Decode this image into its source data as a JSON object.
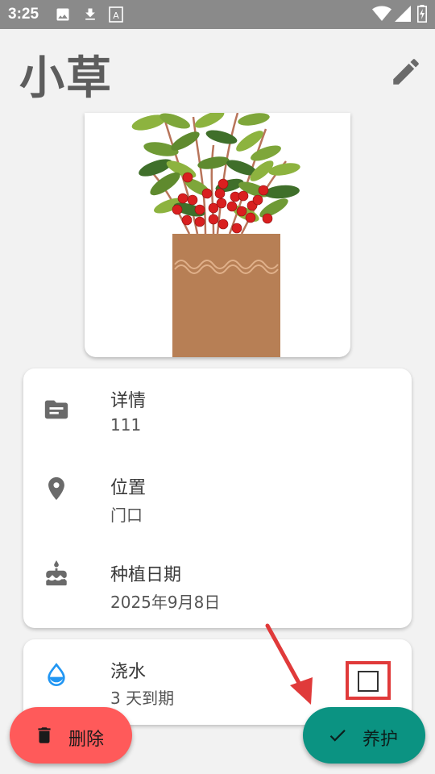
{
  "status_bar": {
    "time": "3:25",
    "icons": [
      "image-icon",
      "download-icon",
      "a-box-icon",
      "wifi-icon",
      "signal-icon",
      "battery-icon"
    ]
  },
  "header": {
    "title": "小草",
    "edit_icon": "pencil-icon"
  },
  "plant_image": {
    "subject": "potted-berry-plant"
  },
  "details": [
    {
      "icon": "note-icon",
      "label": "详情",
      "value": "111"
    },
    {
      "icon": "location-pin-icon",
      "label": "位置",
      "value": "门口"
    },
    {
      "icon": "cake-icon",
      "label": "种植日期",
      "value": "2025年9月8日"
    }
  ],
  "water": {
    "icon": "water-drop-icon",
    "label": "浇水",
    "value": "3 天到期",
    "checked": false
  },
  "actions": {
    "delete_label": "删除",
    "care_label": "养护"
  },
  "colors": {
    "status_bar": "#8a8a8a",
    "title": "#5d5d5d",
    "delete_fab": "#ff5a5a",
    "care_fab": "#0b9382",
    "water_icon": "#2196f3",
    "highlight": "#e03a3a"
  }
}
